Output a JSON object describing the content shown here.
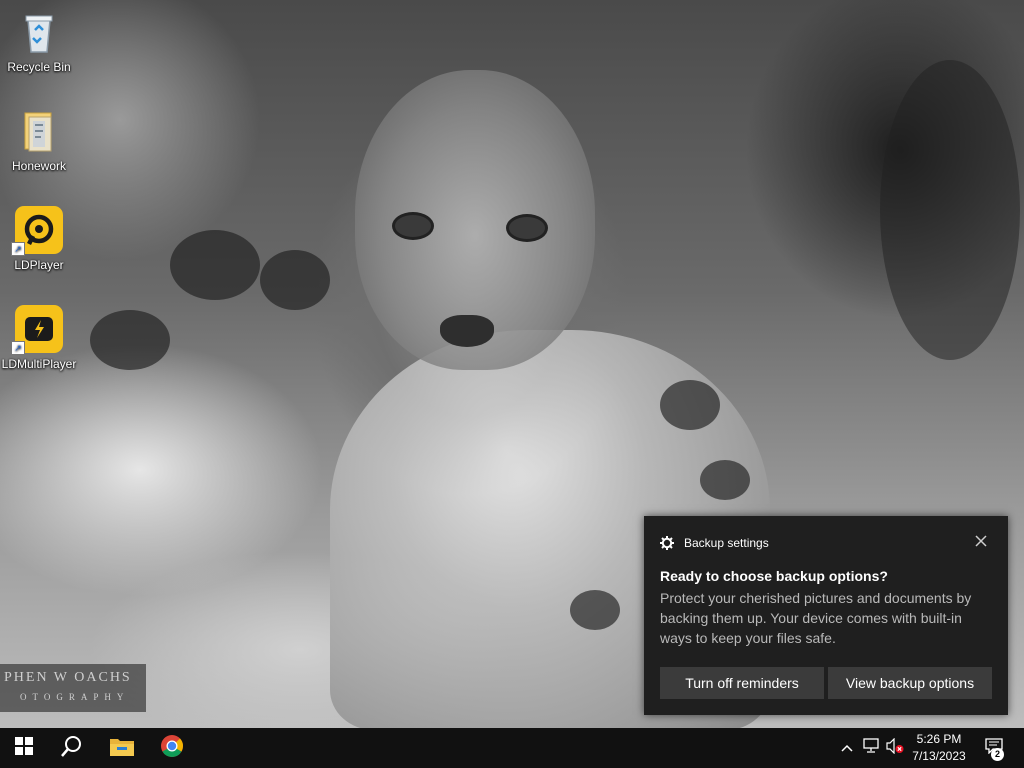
{
  "desktop": {
    "icons": [
      {
        "label": "Recycle Bin",
        "icon": "recycle-bin-icon"
      },
      {
        "label": "Honework",
        "icon": "folder-icon"
      },
      {
        "label": "LDPlayer",
        "icon": "ldplayer-icon"
      },
      {
        "label": "LDMultiPlayer",
        "icon": "ldmultiplayer-icon"
      }
    ],
    "watermark": {
      "line1": "PHEN W OACHS",
      "line2": "OTOGRAPHY"
    }
  },
  "toast": {
    "app": "Backup settings",
    "title": "Ready to choose backup options?",
    "body": "Protect your cherished pictures and documents by backing them up. Your device comes with built-in ways to keep your files safe.",
    "buttons": [
      "Turn off reminders",
      "View backup options"
    ],
    "bg_color": "#1f1f1f",
    "button_color": "#3b3b3b"
  },
  "taskbar": {
    "pinned": [
      "windows-start-icon",
      "search-icon",
      "file-explorer-icon",
      "chrome-icon"
    ],
    "tray_icons": [
      "chevron-up-icon",
      "network-icon",
      "volume-muted-icon"
    ],
    "time": "5:26 PM",
    "date": "7/13/2023",
    "notification_count": "2",
    "bg_color": "#111111"
  }
}
